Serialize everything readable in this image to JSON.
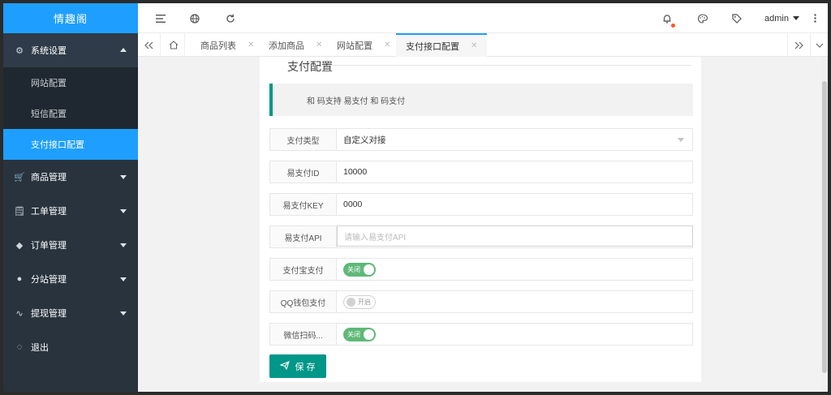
{
  "sidebar": {
    "logo": "情趣阁",
    "menu": [
      {
        "label": "系统设置",
        "icon": "gear-icon",
        "glyph": "⚙"
      },
      {
        "label": "商品管理",
        "icon": "cart-icon",
        "glyph": "🛒"
      },
      {
        "label": "工单管理",
        "icon": "ticket-icon",
        "glyph": "🗒"
      },
      {
        "label": "订单管理",
        "icon": "box-icon",
        "glyph": "◆"
      },
      {
        "label": "分站管理",
        "icon": "globe-icon",
        "glyph": "●"
      },
      {
        "label": "提现管理",
        "icon": "pulse-icon",
        "glyph": "∿"
      },
      {
        "label": "退出",
        "icon": "shield-icon",
        "glyph": "◌"
      }
    ],
    "submenu": [
      {
        "label": "网站配置"
      },
      {
        "label": "短信配置"
      },
      {
        "label": "支付接口配置"
      }
    ]
  },
  "header": {
    "user": "admin"
  },
  "tabs": {
    "items": [
      {
        "label": "商品列表"
      },
      {
        "label": "添加商品"
      },
      {
        "label": "网站配置"
      },
      {
        "label": "支付接口配置"
      }
    ]
  },
  "card": {
    "title": "支付配置",
    "notice": "和 码支持 易支付 和 码支付",
    "fields": {
      "pay_type": {
        "label": "支付类型",
        "value": "自定义对接"
      },
      "epay_id": {
        "label": "易支付ID",
        "value": "10000"
      },
      "epay_key": {
        "label": "易支付KEY",
        "value": "0000"
      },
      "epay_api": {
        "label": "易支付API",
        "placeholder": "请输入易支付API"
      },
      "alipay": {
        "label": "支付宝支付",
        "switch_text": "关闭"
      },
      "qqpay": {
        "label": "QQ钱包支付",
        "switch_text": "开启"
      },
      "wxpay": {
        "label": "微信扫码...",
        "switch_text": "关闭"
      }
    },
    "save_label": "保 存"
  },
  "colors": {
    "accent": "#1e9fff",
    "sidebar": "#28333e",
    "primary_button": "#009688",
    "switch_on": "#5fb878"
  }
}
